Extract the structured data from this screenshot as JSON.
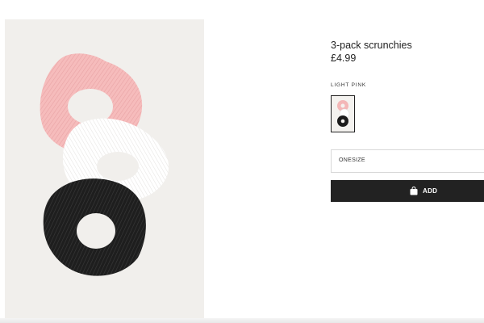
{
  "product": {
    "title": "3-pack scrunchies",
    "price": "£4.99",
    "image_alt": "scrunchies-product-image"
  },
  "color": {
    "label": "LIGHT PINK",
    "swatch_icon": "scrunchies-thumbnail"
  },
  "size": {
    "selected": "ONESIZE"
  },
  "add_button": {
    "label": "ADD",
    "icon": "shopping-bag-icon"
  },
  "colors": {
    "button_bg": "#222222",
    "photo_bg": "#f1efec",
    "pink": "#f5b8b8",
    "white": "#ffffff",
    "black": "#1a1a1a"
  }
}
